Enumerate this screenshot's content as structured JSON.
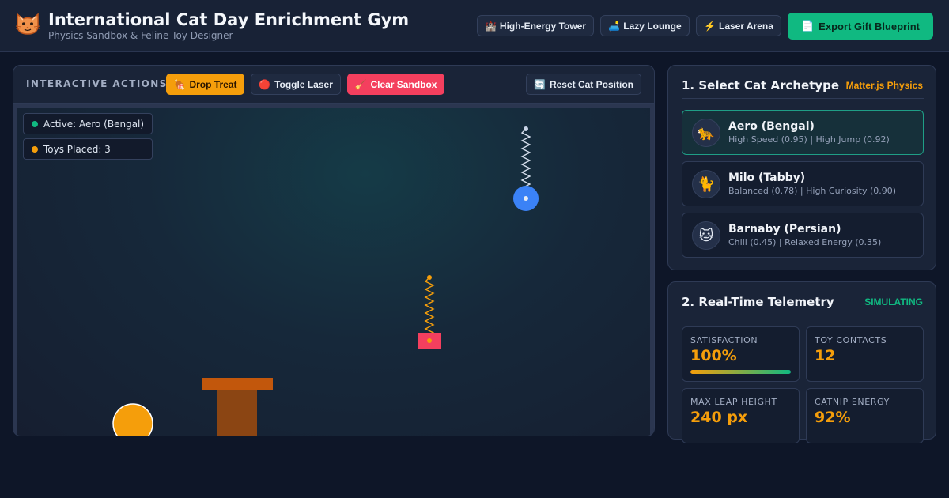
{
  "app": {
    "title": "International Cat Day Enrichment Gym",
    "subtitle": "Physics Sandbox & Feline Toy Designer",
    "logo_icon": "cat-face-icon"
  },
  "presets": [
    {
      "icon": "castle-icon",
      "glyph": "🏰",
      "label": "High-Energy Tower"
    },
    {
      "icon": "couch-icon",
      "glyph": "🛋️",
      "label": "Lazy Lounge"
    },
    {
      "icon": "lightning-icon",
      "glyph": "⚡",
      "label": "Laser Arena"
    }
  ],
  "export": {
    "icon": "document-icon",
    "glyph": "📄",
    "label": "Export Gift Blueprint"
  },
  "actions": {
    "label": "INTERACTIVE ACTIONS:",
    "drop_treat": {
      "glyph": "🍖",
      "label": "Drop Treat"
    },
    "toggle_laser": {
      "glyph": "🔴",
      "label": "Toggle Laser"
    },
    "clear_sandbox": {
      "glyph": "🧹",
      "label": "Clear Sandbox"
    },
    "reset_cat": {
      "glyph": "🔄",
      "label": "Reset Cat Position"
    }
  },
  "sandbox": {
    "active_label": "Active: Aero (Bengal)",
    "active_color": "#10b981",
    "toys_label": "Toys Placed: 3",
    "toys_color": "#f59e0b"
  },
  "archetypes": {
    "title": "1. Select Cat Archetype",
    "tag": "Matter.js Physics",
    "tag_color": "#f59e0b",
    "items": [
      {
        "glyph": "🐆",
        "name": "Aero (Bengal)",
        "stats": "High Speed (0.95) | High Jump (0.92)",
        "active": true
      },
      {
        "glyph": "🐈",
        "name": "Milo (Tabby)",
        "stats": "Balanced (0.78) | High Curiosity (0.90)",
        "active": false
      },
      {
        "glyph": "🐱",
        "name": "Barnaby (Persian)",
        "stats": "Chill (0.45) | Relaxed Energy (0.35)",
        "active": false
      }
    ]
  },
  "telemetry": {
    "title": "2. Real-Time Telemetry",
    "status": "SIMULATING",
    "status_color": "#10b981",
    "metrics": [
      {
        "label": "SATISFACTION",
        "value": "100%",
        "level": 1.0
      },
      {
        "label": "TOY CONTACTS",
        "value": "12"
      },
      {
        "label": "MAX LEAP HEIGHT",
        "value": "240 px"
      },
      {
        "label": "CATNIP ENERGY",
        "value": "92%"
      }
    ]
  },
  "colors": {
    "accent_orange": "#f59e0b",
    "accent_green": "#10b981",
    "accent_red": "#f43f5e",
    "ball_blue": "#3b82f6",
    "toy_pink": "#f43f5e",
    "tower_brown": "#8b4513"
  }
}
